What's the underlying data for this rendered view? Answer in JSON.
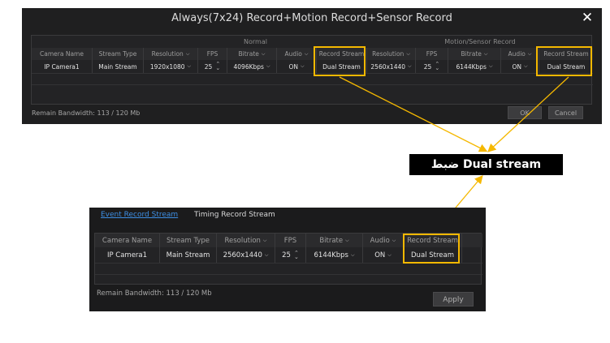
{
  "top_dialog": {
    "title": "Always(7x24) Record+Motion Record+Sensor Record",
    "group_normal": "Normal",
    "group_motion": "Motion/Sensor Record",
    "headers": [
      "Camera Name",
      "Stream Type",
      "Resolution",
      "FPS",
      "Bitrate",
      "Audio",
      "Record Stream",
      "Resolution",
      "FPS",
      "Bitrate",
      "Audio",
      "Record Stream"
    ],
    "row": [
      "IP Camera1",
      "Main Stream",
      "1920x1080",
      "25",
      "4096Kbps",
      "ON",
      "Dual Stream",
      "2560x1440",
      "25",
      "6144Kbps",
      "ON",
      "Dual Stream"
    ],
    "bandwidth": "Remain Bandwidth: 113 / 120 Mb",
    "ok_label": "OK",
    "cancel_label": "Cancel"
  },
  "callout": {
    "text": "ضبط Dual stream"
  },
  "bottom_dialog": {
    "tab_event": "Event Record Stream",
    "tab_timing": "Timing Record Stream",
    "headers": [
      "Camera Name",
      "Stream Type",
      "Resolution",
      "FPS",
      "Bitrate",
      "Audio",
      "Record Stream"
    ],
    "row": [
      "IP Camera1",
      "Main Stream",
      "2560x1440",
      "25",
      "6144Kbps",
      "ON",
      "Dual Stream"
    ],
    "bandwidth": "Remain Bandwidth: 113 / 120 Mb",
    "apply_label": "Apply"
  },
  "colors": {
    "highlight": "#f5b800",
    "tab_active": "#3d8fe5",
    "dialog_bg": "#1f1f20"
  }
}
